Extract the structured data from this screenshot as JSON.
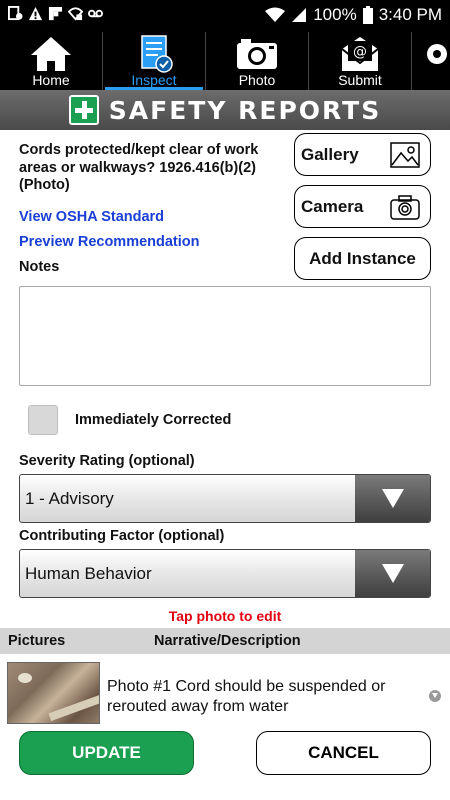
{
  "status_bar": {
    "battery_percent": "100%",
    "time": "3:40 PM",
    "left_icons": [
      "notification-icon",
      "warning-icon",
      "flipboard-icon",
      "wifi-lock-icon",
      "voicemail-icon"
    ],
    "right_icons": [
      "wifi-icon",
      "signal-icon",
      "battery-icon"
    ]
  },
  "nav": {
    "items": [
      {
        "label": "Home",
        "icon": "home-icon"
      },
      {
        "label": "Inspect",
        "icon": "inspect-icon",
        "active": true
      },
      {
        "label": "Photo",
        "icon": "camera-icon"
      },
      {
        "label": "Submit",
        "icon": "submit-icon"
      },
      {
        "label": "",
        "icon": "settings-icon"
      }
    ],
    "active_color": "#2a9df4"
  },
  "banner": {
    "title": "SAFETY REPORTS",
    "icon": "plus-cross-icon",
    "icon_color": "#1aa050"
  },
  "form": {
    "question": "Cords protected/kept clear of work areas or walkways? 1926.416(b)(2) (Photo)",
    "view_osha_link": "View OSHA Standard",
    "preview_link": "Preview Recommendation",
    "notes_label": "Notes",
    "notes_value": "",
    "gallery_label": "Gallery",
    "camera_label": "Camera",
    "add_instance_label": "Add Instance",
    "immediately_corrected_label": "Immediately Corrected",
    "immediately_corrected_checked": false,
    "severity_label": "Severity Rating (optional)",
    "severity_value": "1 - Advisory",
    "contributing_label": "Contributing Factor (optional)",
    "contributing_value": "Human Behavior",
    "tap_hint": "Tap photo to edit",
    "link_color": "#1a3fd6",
    "hint_color": "#e3000f"
  },
  "pictures": {
    "columns": [
      "Pictures",
      "Narrative/Description"
    ],
    "rows": [
      {
        "narrative": "Photo #1 Cord should be suspended or rerouted away from water"
      }
    ]
  },
  "actions": {
    "update_label": "UPDATE",
    "cancel_label": "CANCEL",
    "update_color": "#1aa050"
  }
}
